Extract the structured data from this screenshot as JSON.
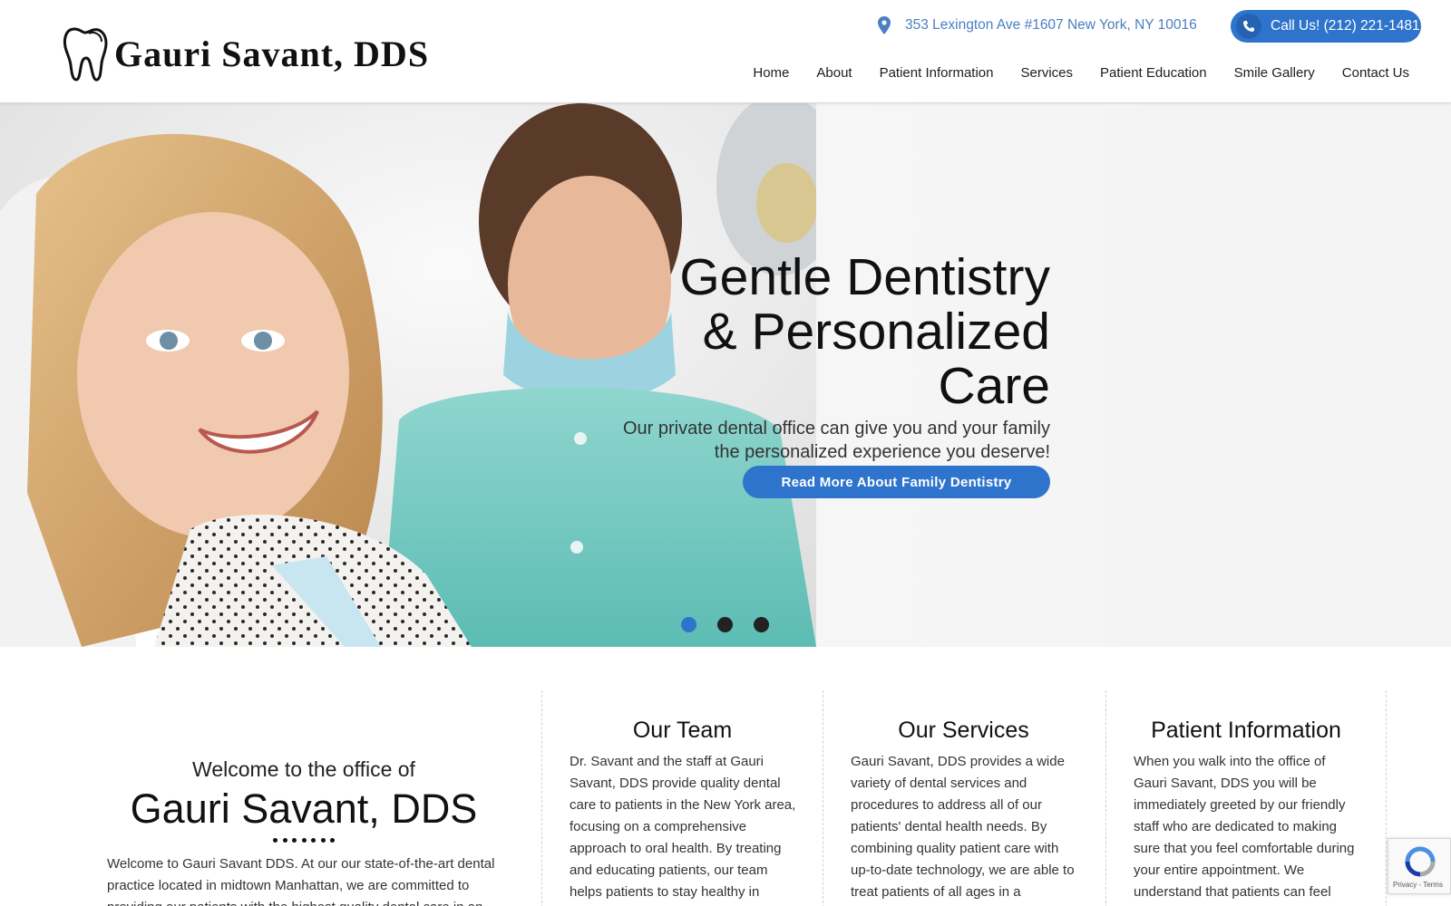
{
  "brand": {
    "name": "Gauri Savant, DDS"
  },
  "contact": {
    "address": "353 Lexington Ave #1607 New York, NY 10016",
    "call_label": "Call Us! (212) 221-1481"
  },
  "nav": {
    "items": [
      {
        "label": "Home"
      },
      {
        "label": "About"
      },
      {
        "label": "Patient Information"
      },
      {
        "label": "Services"
      },
      {
        "label": "Patient Education"
      },
      {
        "label": "Smile Gallery"
      },
      {
        "label": "Contact Us"
      }
    ]
  },
  "hero": {
    "headline_lines": [
      "Gentle Dentistry",
      "& Personalized",
      "Care"
    ],
    "subtext_lines": [
      "Our private dental office can give you and your family",
      "the personalized experience you deserve!"
    ],
    "cta_label": "Read More About Family Dentistry",
    "slides": 3,
    "active_slide": 1
  },
  "welcome": {
    "pre": "Welcome to the office of",
    "name": "Gauri Savant, DDS",
    "body": "Welcome to Gauri Savant DDS. At our our state-of-the-art dental practice located in midtown Manhattan, we are committed to providing our patients with the highest quality dental care in an"
  },
  "columns": [
    {
      "title": "Our Team",
      "body": "Dr. Savant and the staff at Gauri Savant, DDS provide quality dental care to patients in the New York area, focusing on a comprehensive approach to oral health. By treating and educating patients, our team helps patients to stay healthy in"
    },
    {
      "title": "Our Services",
      "body": "Gauri Savant, DDS provides a wide variety of dental services and procedures to address all of our patients' dental health needs. By combining quality patient care with up-to-date technology, we are able to treat patients of all ages in a"
    },
    {
      "title": "Patient Information",
      "body": "When you walk into the office of Gauri Savant, DDS you will be immediately greeted by our friendly staff who are dedicated to making sure that you feel comfortable during your entire appointment. We understand that patients can feel anxious when going"
    }
  ],
  "recaptcha": {
    "links": "Privacy - Terms"
  },
  "colors": {
    "accent": "#2f74cc",
    "address": "#4a7fc1"
  },
  "icons": {
    "logo": "tooth-icon",
    "address": "map-pin-icon",
    "phone": "phone-icon"
  }
}
